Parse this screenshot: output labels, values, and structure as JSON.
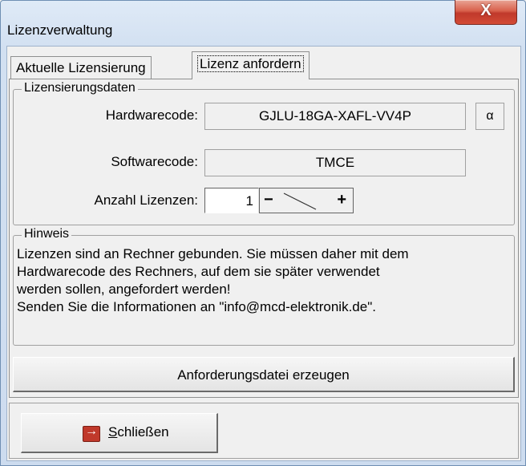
{
  "window": {
    "title": "Lizenzverwaltung",
    "close_symbol": "X"
  },
  "tabs": [
    {
      "label": "Aktuelle Lizensierung",
      "active": false
    },
    {
      "label": "Lizenz anfordern",
      "active": true
    }
  ],
  "licensing_data": {
    "legend": "Lizensierungsdaten",
    "hardwarecode_label": "Hardwarecode:",
    "hardwarecode_value": "GJLU-18GA-XAFL-VV4P",
    "alpha_button": "α",
    "softwarecode_label": "Softwarecode:",
    "softwarecode_value": "TMCE",
    "count_label": "Anzahl Lizenzen:",
    "count_value": "1",
    "minus": "−",
    "plus": "+"
  },
  "note": {
    "legend": "Hinweis",
    "lines": [
      "Lizenzen sind an Rechner gebunden. Sie müssen daher mit dem",
      "Hardwarecode des Rechners, auf dem sie später verwendet",
      "werden sollen, angefordert werden!",
      "Senden Sie die Informationen an \"info@mcd-elektronik.de\"."
    ]
  },
  "buttons": {
    "generate": "Anforderungsdatei erzeugen",
    "close_mnemonic": "S",
    "close_rest": "chließen"
  },
  "icons": {
    "close_window": "close-x-icon",
    "exit": "exit-door-icon"
  }
}
